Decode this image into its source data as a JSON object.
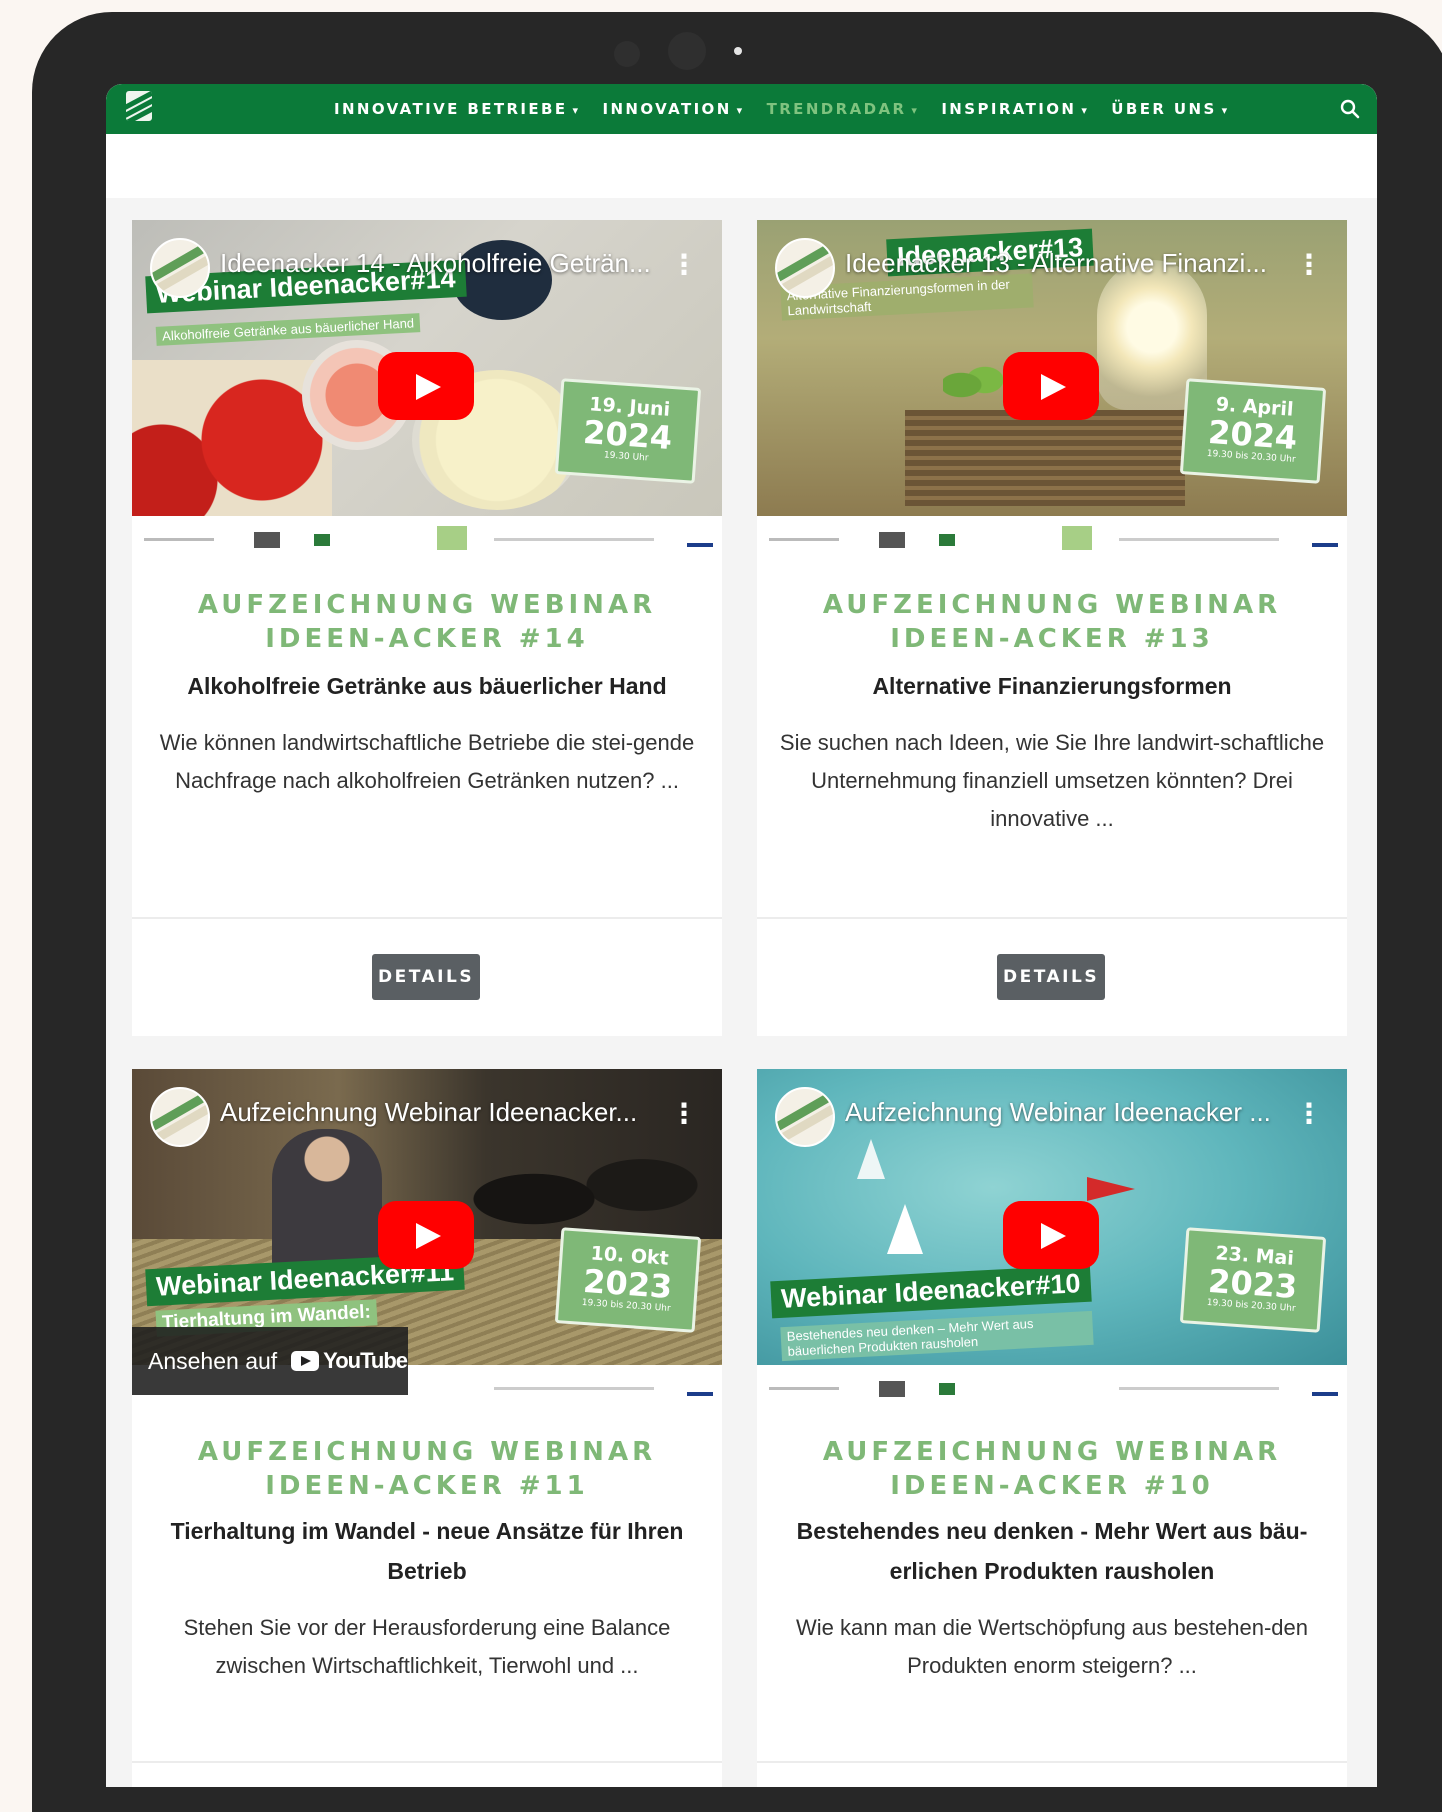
{
  "nav": {
    "items": [
      {
        "label": "INNOVATIVE BETRIEBE"
      },
      {
        "label": "INNOVATION"
      },
      {
        "label": "TRENDRADAR"
      },
      {
        "label": "INSPIRATION"
      },
      {
        "label": "ÜBER UNS"
      }
    ],
    "active_item": "TRENDRADAR",
    "caret_icon": "▾",
    "search_icon": "search-icon"
  },
  "colors": {
    "nav_bg": "#0b7a39",
    "nav_active": "#7fc37f",
    "heading_green": "#7fb877",
    "button_bg": "#5a5f63",
    "play_red": "#ff0000"
  },
  "cards": [
    {
      "video": {
        "title": "Ideenacker 14 - Alkoholfreie Geträn...",
        "webinar": "Webinar Ideenacker#14",
        "subtitle": "Alkoholfreie Getränke aus bäuerlicher Hand",
        "date_day": "19. Juni",
        "date_year": "2024",
        "date_time": "19.30 Uhr"
      },
      "heading": "AUFZEICHNUNG WEBINAR IDEEN-ACKER #14",
      "subheading": "Alkoholfreie Getränke aus bäuerlicher Hand",
      "description": "Wie können landwirtschaftliche Betriebe die stei-gende Nachfrage nach alkoholfreien Getränken nutzen? ...",
      "button": "DETAILS"
    },
    {
      "video": {
        "title": "Ideenacker 13 - Alternative Finanzi...",
        "webinar": "Ideenacker#13",
        "subtitle": "Alternative Finanzierungsformen in der Landwirtschaft",
        "date_day": "9. April",
        "date_year": "2024",
        "date_time": "19.30 bis 20.30 Uhr"
      },
      "heading": "AUFZEICHNUNG WEBINAR IDEEN-ACKER #13",
      "subheading": "Alternative Finanzierungsformen",
      "description": "Sie suchen nach Ideen, wie Sie Ihre landwirt-schaftliche Unternehmung finanziell umsetzen könnten? Drei innovative ...",
      "button": "DETAILS"
    },
    {
      "video": {
        "title": "Aufzeichnung Webinar Ideenacker...",
        "webinar": "Webinar Ideenacker#11",
        "subtitle": "Tierhaltung im Wandel:",
        "date_day": "10. Okt",
        "date_year": "2023",
        "date_time": "19.30 bis 20.30 Uhr",
        "watch_on": "Ansehen auf",
        "watch_brand": "YouTube"
      },
      "heading": "AUFZEICHNUNG WEBINAR IDEEN-ACKER #11",
      "subheading": "Tierhaltung im Wandel - neue Ansätze für Ihren Betrieb",
      "description": "Stehen Sie vor der Herausforderung eine Balance zwischen Wirtschaftlichkeit, Tierwohl und ..."
    },
    {
      "video": {
        "title": "Aufzeichnung Webinar Ideenacker ...",
        "webinar": "Webinar Ideenacker#10",
        "subtitle": "Bestehendes neu denken – Mehr Wert aus bäuerlichen Produkten rausholen",
        "date_day": "23. Mai",
        "date_year": "2023",
        "date_time": "19.30 bis 20.30 Uhr"
      },
      "heading": "AUFZEICHNUNG WEBINAR IDEEN-ACKER #10",
      "subheading": "Bestehendes neu denken - Mehr Wert aus bäu-erlichen Produkten rausholen",
      "description": "Wie kann man die Wertschöpfung aus bestehen-den Produkten enorm steigern? ..."
    }
  ]
}
